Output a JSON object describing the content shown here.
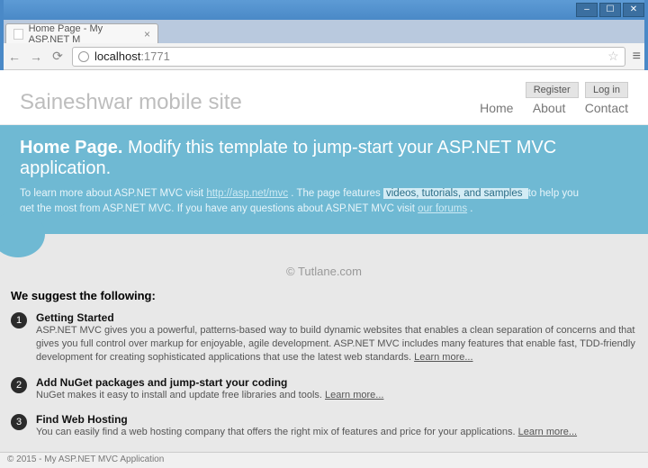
{
  "browser": {
    "tab_title": "Home Page - My ASP.NET M",
    "url_host": "localhost",
    "url_port": ":1771"
  },
  "window_controls": {
    "min": "–",
    "max": "☐",
    "close": "✕"
  },
  "header": {
    "brand": "Saineshwar mobile site",
    "register": "Register",
    "login": "Log in",
    "nav": {
      "home": "Home",
      "about": "About",
      "contact": "Contact"
    }
  },
  "hero": {
    "title_strong": "Home Page.",
    "title_rest": " Modify this template to jump-start your ASP.NET MVC application.",
    "para_pre": "To learn more about ASP.NET MVC visit ",
    "link1": "http://asp.net/mvc",
    "para_mid1": " . The page features ",
    "highlight": " videos, tutorials, and samples ",
    "para_mid2": " to help you get the most from ASP.NET MVC. If you have any questions about ASP.NET MVC visit ",
    "link2": "our forums",
    "para_end": " ."
  },
  "watermark": "© Tutlane.com",
  "suggest": {
    "heading": "We suggest the following:",
    "items": [
      {
        "num": "1",
        "title": "Getting Started",
        "desc": "ASP.NET MVC gives you a powerful, patterns-based way to build dynamic websites that enables a clean separation of concerns and that gives you full control over markup for enjoyable, agile development. ASP.NET MVC includes many features that enable fast, TDD-friendly development for creating sophisticated applications that use the latest web standards. ",
        "learn": "Learn more..."
      },
      {
        "num": "2",
        "title": "Add NuGet packages and jump-start your coding",
        "desc": "NuGet makes it easy to install and update free libraries and tools. ",
        "learn": "Learn more..."
      },
      {
        "num": "3",
        "title": "Find Web Hosting",
        "desc": "You can easily find a web hosting company that offers the right mix of features and price for your applications. ",
        "learn": "Learn more..."
      }
    ]
  },
  "footer": "© 2015 - My ASP.NET MVC Application"
}
